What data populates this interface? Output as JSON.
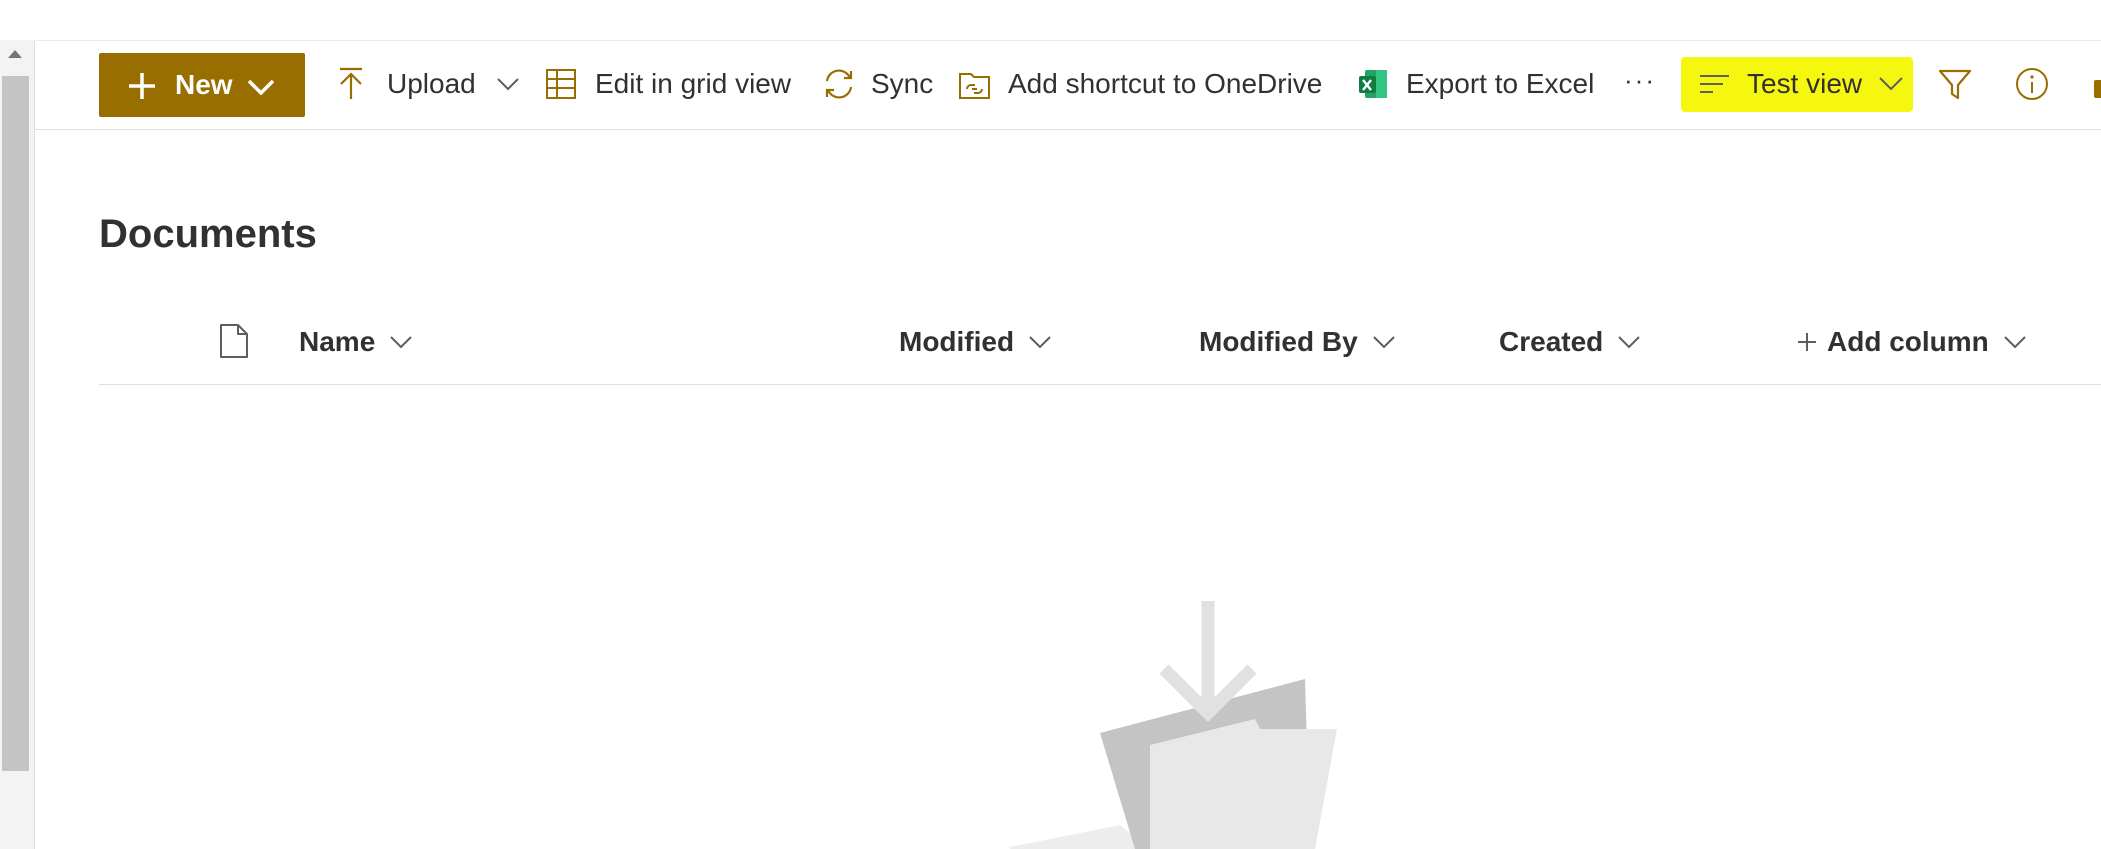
{
  "command_bar": {
    "new_label": "New",
    "upload_label": "Upload",
    "edit_grid_label": "Edit in grid view",
    "sync_label": "Sync",
    "add_shortcut_label": "Add shortcut to OneDrive",
    "export_label": "Export to Excel",
    "more_label": "···",
    "view_label": "Test view",
    "icons": [
      "plus-icon",
      "chevron-down-icon",
      "upload-arrow-icon",
      "grid-icon",
      "sync-icon",
      "shortcut-folder-icon",
      "excel-icon",
      "lines-icon",
      "filter-icon",
      "info-icon"
    ]
  },
  "library": {
    "title": "Documents"
  },
  "columns": {
    "name": "Name",
    "modified": "Modified",
    "modified_by": "Modified By",
    "created": "Created",
    "add_column": "Add column"
  },
  "colors": {
    "accent": "#996e00",
    "highlight": "#f6f70e",
    "empty_state_gray": "#c4c4c4"
  }
}
